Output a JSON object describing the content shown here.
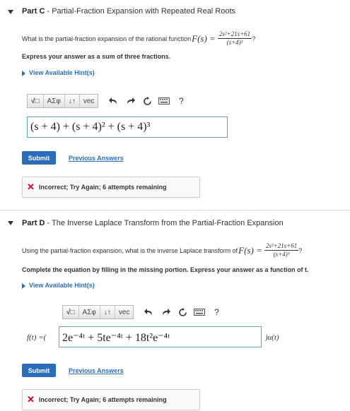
{
  "partC": {
    "header_label": "Part C",
    "header_title": "Partial-Fraction Expansion with Repeated Real Roots",
    "question_prefix": "What is the partial-fraction expansion of the rational function ",
    "function_lhs": "F(s) =",
    "frac_num": "2s²+21s+61",
    "frac_den": "(s+4)³",
    "question_suffix": "?",
    "instruction": "Express your answer as a sum of three fractions.",
    "hint_label": "View Available Hint(s)",
    "toolbar": {
      "sqrt_btn": "√□",
      "greek_btn": "ΑΣφ",
      "arrows_btn": "↓↑",
      "vec_btn": "vec",
      "help_btn": "?"
    },
    "answer_value": "(s + 4) + (s + 4)² + (s + 4)³",
    "submit_label": "Submit",
    "previous_answers_label": "Previous Answers",
    "feedback_text": "Incorrect; Try Again; 6 attempts remaining"
  },
  "partD": {
    "header_label": "Part D",
    "header_title": "The Inverse Laplace Transform from the Partial-Fraction Expansion",
    "question_prefix": "Using the partial-fraction expansion, what is the inverse Laplace transform of ",
    "function_lhs": "F(s) =",
    "frac_num": "2s²+21s+61",
    "frac_den": "(s+4)³",
    "question_suffix": "?",
    "instruction": "Complete the equation by filling in the missing portion. Express your answer as a function of t.",
    "hint_label": "View Available Hint(s)",
    "toolbar": {
      "sqrt_btn": "√□",
      "greek_btn": "ΑΣφ",
      "arrows_btn": "↓↑",
      "vec_btn": "vec",
      "help_btn": "?"
    },
    "equation_prefix": "f(t) =(",
    "answer_value": "2e⁻⁴ᵗ + 5te⁻⁴ᵗ + 18t²e⁻⁴ᵗ",
    "equation_suffix": ")u(t)",
    "submit_label": "Submit",
    "previous_answers_label": "Previous Answers",
    "feedback_text": "Incorrect; Try Again; 6 attempts remaining"
  },
  "colors": {
    "link_blue": "#2a6ebb",
    "error_red": "#d0021b",
    "answer_border": "#5fae8f"
  },
  "icons": [
    "collapse-triangle-icon",
    "undo-icon",
    "redo-icon",
    "reset-icon",
    "keyboard-icon",
    "help-icon",
    "incorrect-x-icon",
    "expand-arrow-icon"
  ]
}
